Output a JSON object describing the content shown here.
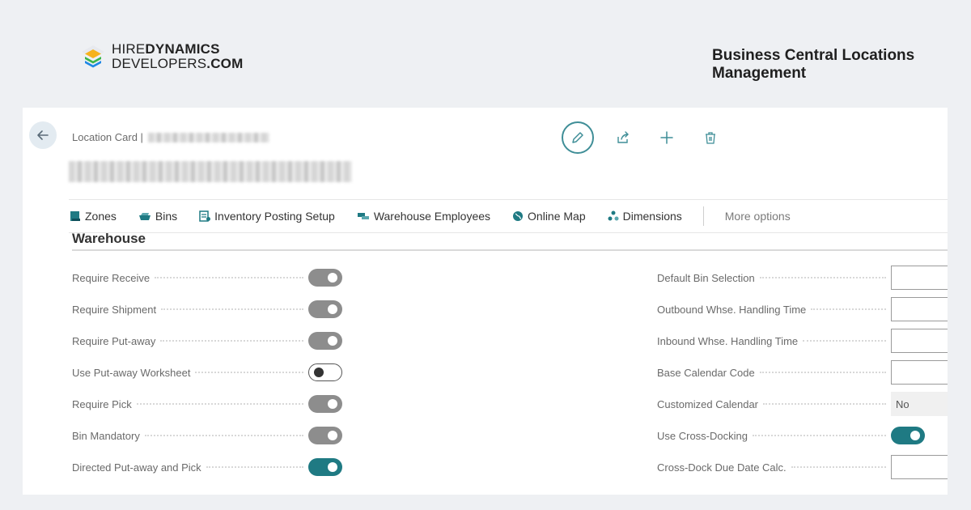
{
  "brand": {
    "line1_regular": "HIRE",
    "line1_bold": "DYNAMICS",
    "line2_regular": "DEVELOPERS",
    "line2_bold": ".COM"
  },
  "headline": "Business Central Locations Management",
  "page": {
    "breadcrumb": "Location Card |"
  },
  "colors": {
    "accent": "#1f7a83",
    "toggle_disabled": "#8d8d8d"
  },
  "toolbar": {
    "items": [
      {
        "label": "Zones",
        "icon": "zones-icon"
      },
      {
        "label": "Bins",
        "icon": "bins-icon"
      },
      {
        "label": "Inventory Posting Setup",
        "icon": "posting-setup-icon"
      },
      {
        "label": "Warehouse Employees",
        "icon": "employees-icon"
      },
      {
        "label": "Online Map",
        "icon": "globe-icon"
      },
      {
        "label": "Dimensions",
        "icon": "dimensions-icon"
      }
    ],
    "more": "More options"
  },
  "section": {
    "title": "Warehouse"
  },
  "left_fields": [
    {
      "label": "Require Receive",
      "state": "on-gray"
    },
    {
      "label": "Require Shipment",
      "state": "on-gray"
    },
    {
      "label": "Require Put-away",
      "state": "on-gray"
    },
    {
      "label": "Use Put-away Worksheet",
      "state": "off"
    },
    {
      "label": "Require Pick",
      "state": "on-gray"
    },
    {
      "label": "Bin Mandatory",
      "state": "on-gray"
    },
    {
      "label": "Directed Put-away and Pick",
      "state": "on-teal"
    }
  ],
  "right_fields": [
    {
      "label": "Default Bin Selection",
      "type": "input",
      "value": ""
    },
    {
      "label": "Outbound Whse. Handling Time",
      "type": "input",
      "value": ""
    },
    {
      "label": "Inbound Whse. Handling Time",
      "type": "input",
      "value": ""
    },
    {
      "label": "Base Calendar Code",
      "type": "input",
      "value": ""
    },
    {
      "label": "Customized Calendar",
      "type": "readonly",
      "value": "No"
    },
    {
      "label": "Use Cross-Docking",
      "type": "toggle",
      "state": "on-teal"
    },
    {
      "label": "Cross-Dock Due Date Calc.",
      "type": "input",
      "value": ""
    }
  ]
}
